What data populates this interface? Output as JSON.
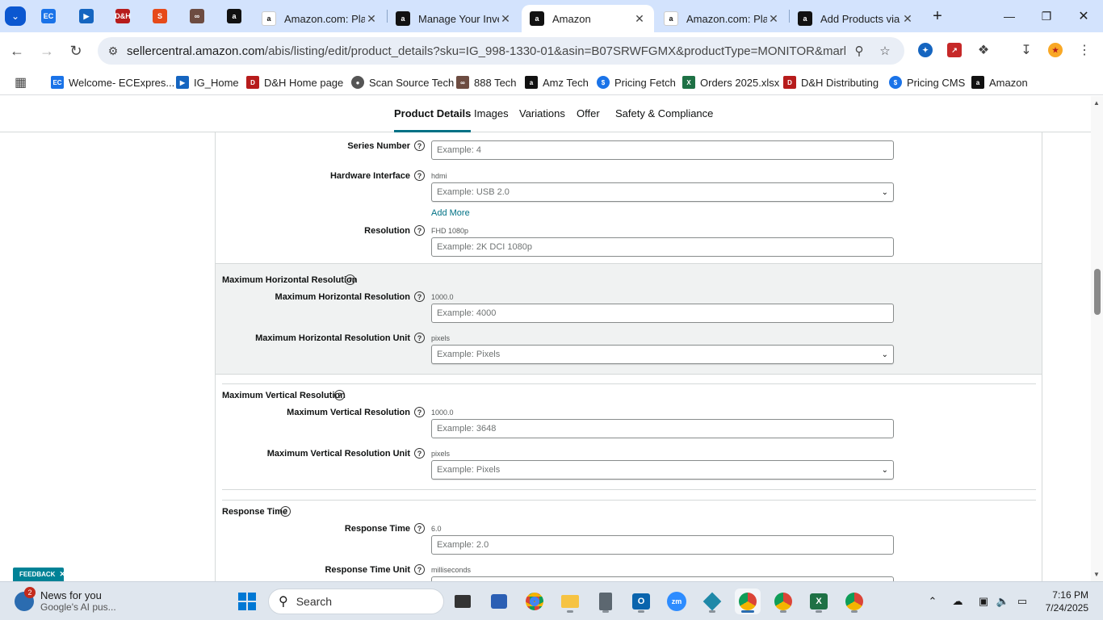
{
  "browser": {
    "tabs": [
      {
        "title": "Amazon.com: Pla",
        "active": false
      },
      {
        "title": "Manage Your Inve",
        "active": false
      },
      {
        "title": "Amazon",
        "active": true
      },
      {
        "title": "Amazon.com: Pla",
        "active": false
      },
      {
        "title": "Add Products via",
        "active": false
      }
    ],
    "pinned_labels": {
      "ec": "EC",
      "dh": "D&H"
    },
    "url_host": "sellercentral.amazon.com",
    "url_path": "/abis/listing/edit/product_details?sku=IG_998-1330-01&asin=B07SRWFGMX&productType=MONITOR&marketplace..."
  },
  "bookmarks": [
    {
      "label": "Welcome- ECExpres...",
      "icon": "ec-icon",
      "color": "#1a73e8"
    },
    {
      "label": "IG_Home",
      "icon": "ig-icon",
      "color": "#1565c0"
    },
    {
      "label": "D&H Home page",
      "icon": "dh-icon",
      "color": "#b71c1c"
    },
    {
      "label": "Scan Source Tech",
      "icon": "globe-icon",
      "color": "#444444"
    },
    {
      "label": "888 Tech",
      "icon": "888-icon",
      "color": "#e65100"
    },
    {
      "label": "Amz Tech",
      "icon": "amazon-icon",
      "color": "#111111"
    },
    {
      "label": "Pricing Fetch",
      "icon": "dollar-icon",
      "color": "#1a73e8"
    },
    {
      "label": "Orders 2025.xlsx",
      "icon": "excel-icon",
      "color": "#1e7145"
    },
    {
      "label": "D&H Distributing",
      "icon": "dh-icon",
      "color": "#b71c1c"
    },
    {
      "label": "Pricing CMS",
      "icon": "dollar-icon",
      "color": "#1a73e8"
    },
    {
      "label": "Amazon",
      "icon": "amazon-icon",
      "color": "#111111"
    }
  ],
  "subnav": [
    "Product Details",
    "Images",
    "Variations",
    "Offer",
    "Safety & Compliance"
  ],
  "form": {
    "series_number": {
      "label": "Series Number",
      "placeholder": "Example: 4"
    },
    "hardware_interface": {
      "label": "Hardware Interface",
      "current": "hdmi",
      "placeholder": "Example: USB 2.0",
      "add_more": "Add More"
    },
    "resolution": {
      "label": "Resolution",
      "current": "FHD 1080p",
      "placeholder": "Example: 2K DCI 1080p"
    },
    "max_h_res_section": "Maximum Horizontal Resolution",
    "max_h_res": {
      "label": "Maximum Horizontal Resolution",
      "current": "1000.0",
      "placeholder": "Example: 4000"
    },
    "max_h_res_unit": {
      "label": "Maximum Horizontal Resolution Unit",
      "current": "pixels",
      "placeholder": "Example: Pixels"
    },
    "max_v_res_section": "Maximum Vertical Resolution",
    "max_v_res": {
      "label": "Maximum Vertical Resolution",
      "current": "1000.0",
      "placeholder": "Example: 3648"
    },
    "max_v_res_unit": {
      "label": "Maximum Vertical Resolution Unit",
      "current": "pixels",
      "placeholder": "Example: Pixels"
    },
    "response_time_section": "Response Time",
    "response_time": {
      "label": "Response Time",
      "current": "6.0",
      "placeholder": "Example: 2.0"
    },
    "response_time_unit": {
      "label": "Response Time Unit",
      "current": "milliseconds"
    }
  },
  "feedback_label": "FEEDBACK",
  "taskbar": {
    "news_badge": "2",
    "news_title": "News for you",
    "news_sub": "Google's AI pus...",
    "search_label": "Search",
    "time": "7:16 PM",
    "date": "7/24/2025"
  },
  "colors": {
    "accent": "#007185",
    "tab_strip": "#d3e3fd",
    "band": "#f0f2f2"
  }
}
